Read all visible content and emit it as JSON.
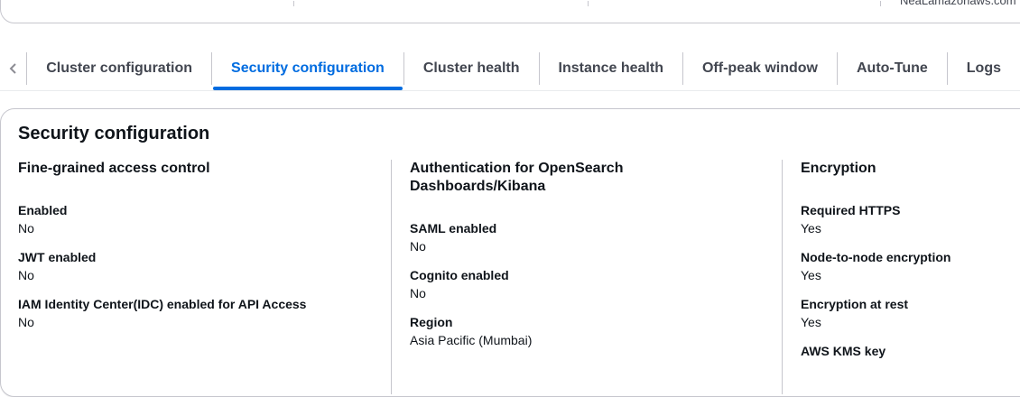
{
  "top_card": {
    "clipped_text": "NeaLamazonaws.com"
  },
  "tabs": [
    {
      "label": "Cluster configuration",
      "active": false
    },
    {
      "label": "Security configuration",
      "active": true
    },
    {
      "label": "Cluster health",
      "active": false
    },
    {
      "label": "Instance health",
      "active": false
    },
    {
      "label": "Off-peak window",
      "active": false
    },
    {
      "label": "Auto-Tune",
      "active": false
    },
    {
      "label": "Logs",
      "active": false
    }
  ],
  "panel": {
    "title": "Security configuration",
    "columns": [
      {
        "heading": "Fine-grained access control",
        "items": [
          {
            "key": "Enabled",
            "value": "No"
          },
          {
            "key": "JWT enabled",
            "value": "No"
          },
          {
            "key": "IAM Identity Center(IDC) enabled for API Access",
            "value": "No"
          }
        ]
      },
      {
        "heading": "Authentication for OpenSearch Dashboards/Kibana",
        "items": [
          {
            "key": "SAML enabled",
            "value": "No"
          },
          {
            "key": "Cognito enabled",
            "value": "No"
          },
          {
            "key": "Region",
            "value": "Asia Pacific (Mumbai)"
          }
        ]
      },
      {
        "heading": "Encryption",
        "items": [
          {
            "key": "Required HTTPS",
            "value": "Yes"
          },
          {
            "key": "Node-to-node encryption",
            "value": "Yes"
          },
          {
            "key": "Encryption at rest",
            "value": "Yes"
          },
          {
            "key": "AWS KMS key",
            "value": ""
          }
        ]
      }
    ]
  }
}
